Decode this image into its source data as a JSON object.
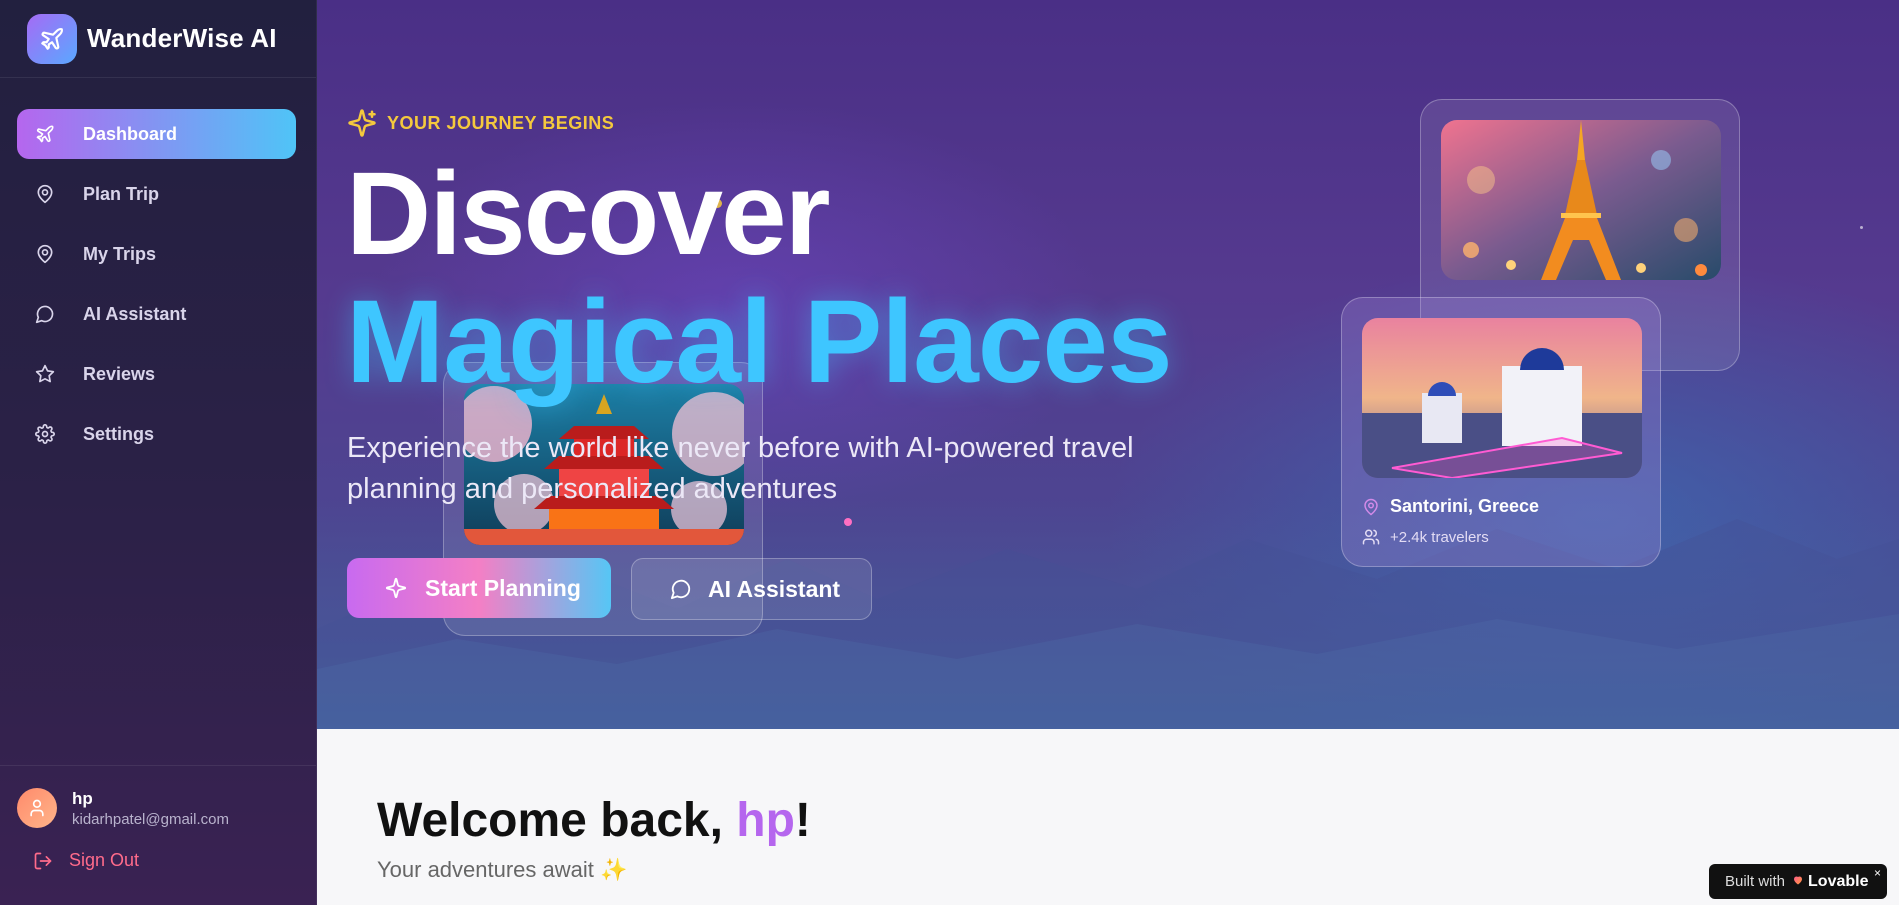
{
  "app": {
    "name": "WanderWise AI"
  },
  "sidebar": {
    "items": [
      {
        "label": "Dashboard",
        "icon": "plane-icon",
        "active": true
      },
      {
        "label": "Plan Trip",
        "icon": "map-pin-icon",
        "active": false
      },
      {
        "label": "My Trips",
        "icon": "map-pin-icon",
        "active": false
      },
      {
        "label": "AI Assistant",
        "icon": "chat-bubble-icon",
        "active": false
      },
      {
        "label": "Reviews",
        "icon": "star-icon",
        "active": false
      },
      {
        "label": "Settings",
        "icon": "gear-icon",
        "active": false
      }
    ],
    "user": {
      "name": "hp",
      "email": "kidarhpatel@gmail.com"
    },
    "signout_label": "Sign Out"
  },
  "hero": {
    "eyebrow": "YOUR JOURNEY BEGINS",
    "headline_line1": "Discover",
    "headline_line2": "Magical Places",
    "subtitle": "Experience the world like never before with AI-powered travel planning and personalized adventures",
    "primary_button": "Start Planning",
    "secondary_button": "AI Assistant",
    "featured_card": {
      "location": "Santorini, Greece",
      "travelers": "+2.4k travelers"
    }
  },
  "welcome": {
    "prefix": "Welcome back, ",
    "name": "hp",
    "suffix": "!",
    "subtitle": "Your adventures await ✨"
  },
  "badge": {
    "prefix": "Built with",
    "brand": "Lovable",
    "close": "×"
  },
  "colors": {
    "accent_purple": "#b566ee",
    "accent_cyan": "#3ec6ff",
    "eyebrow_gold": "#f4c93d",
    "signout_red": "#ff6b8b"
  }
}
